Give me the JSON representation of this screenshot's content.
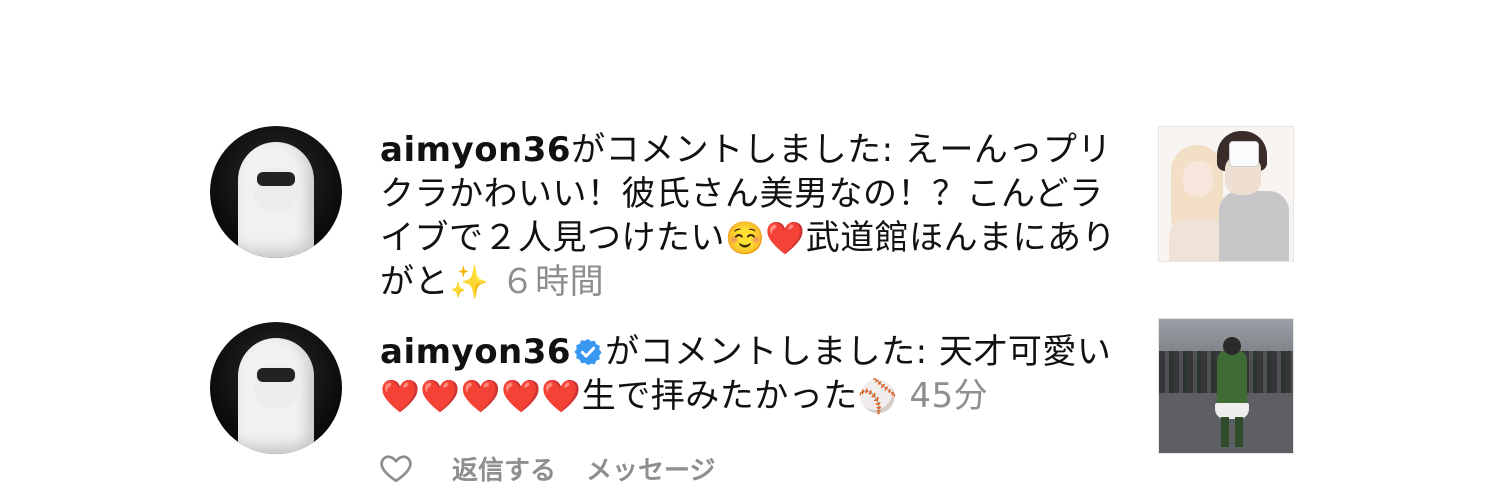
{
  "notifications": [
    {
      "username": "aimyon36",
      "verified": false,
      "text_parts": [
        "がコメントしました: えーんっプリクラかわいい！彼氏さん美男なの！？こんどライブで２人見つけたい",
        "☺️",
        "❤️",
        "武道館ほんまにありがと",
        "✨"
      ],
      "time": "６時間",
      "avatar_icon": "avatar-hooded-person",
      "thumbnail_icon": "purikura-photo-thumbnail"
    },
    {
      "username": "aimyon36",
      "verified": true,
      "text_parts": [
        "がコメントしました: 天才可愛い",
        "❤️❤️❤️❤️❤️",
        "生で拝みたかった",
        "⚾"
      ],
      "time": "45分",
      "avatar_icon": "avatar-hooded-person",
      "thumbnail_icon": "baseball-photo-thumbnail"
    }
  ],
  "actions": {
    "like_icon": "heart-outline-icon",
    "reply_label": "返信する",
    "message_label": "メッセージ"
  },
  "colors": {
    "text": "#111111",
    "secondary": "#8e8e8e",
    "verified_blue": "#3897f0"
  }
}
